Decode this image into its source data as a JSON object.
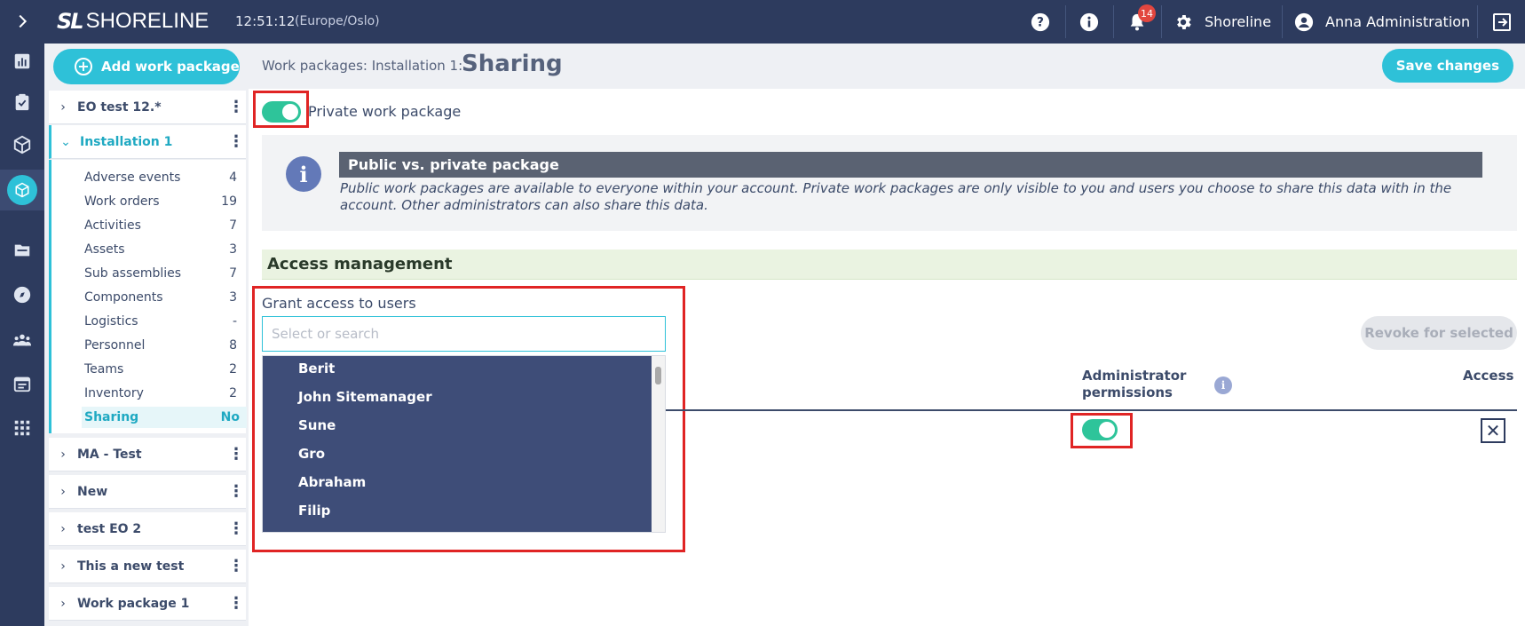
{
  "app": {
    "logo_mark": "SL",
    "logo_text": "SHORELINE",
    "clock": "12:51:12",
    "timezone": "(Europe/Oslo)"
  },
  "topbar": {
    "notifications_count": "14",
    "org_label": "Shoreline",
    "user_label": "Anna Administration",
    "icons": [
      "help-icon",
      "info-icon",
      "bell-icon",
      "gear-icon",
      "user-icon",
      "logout-icon"
    ]
  },
  "rail": {
    "icons": [
      "expand-icon",
      "dashboard-icon",
      "tasks-icon",
      "package-icon",
      "workpackage-icon",
      "folder-icon",
      "compass-icon",
      "people-icon",
      "calendar-icon",
      "grid-icon"
    ]
  },
  "sidebar": {
    "add_label": "Add work package",
    "packages_top": [
      {
        "name": "EO test 12.*"
      },
      {
        "name": "Installation 1"
      }
    ],
    "sub_items": [
      {
        "label": "Adverse events",
        "count": "4"
      },
      {
        "label": "Work orders",
        "count": "19"
      },
      {
        "label": "Activities",
        "count": "7"
      },
      {
        "label": "Assets",
        "count": "3"
      },
      {
        "label": "Sub assemblies",
        "count": "7"
      },
      {
        "label": "Components",
        "count": "3"
      },
      {
        "label": "Logistics",
        "count": "-"
      },
      {
        "label": "Personnel",
        "count": "8"
      },
      {
        "label": "Teams",
        "count": "2"
      },
      {
        "label": "Inventory",
        "count": "2"
      },
      {
        "label": "Sharing",
        "count": "No"
      }
    ],
    "packages_bottom": [
      {
        "name": "MA - Test"
      },
      {
        "name": "New"
      },
      {
        "name": "test EO 2"
      },
      {
        "name": "This a new test"
      },
      {
        "name": "Work package 1"
      }
    ]
  },
  "header": {
    "breadcrumb": "Work packages:  Installation 1:",
    "title": "Sharing",
    "save_label": "Save changes"
  },
  "private_toggle": {
    "label": "Private work package",
    "on": true
  },
  "info": {
    "title": "Public vs. private package",
    "text": "Public work packages are available to everyone within your account. Private work packages are only visible to you and users you choose to share this data with in the account. Other administrators can also share this data."
  },
  "access": {
    "heading": "Access management",
    "grant_label": "Grant access to users",
    "search_placeholder": "Select or search",
    "users": [
      "Berit",
      "John Sitemanager",
      "Sune",
      "Gro",
      "Abraham",
      "Filip"
    ],
    "revoke_label": "Revoke for selected",
    "col_admin": "Administrator permissions",
    "col_access": "Access",
    "row_admin_toggle_on": true
  },
  "colors": {
    "accent": "#2ec1d8",
    "toggle_on": "#2ec49a",
    "nav_bg": "#2d3b5e",
    "highlight": "#e02424"
  }
}
